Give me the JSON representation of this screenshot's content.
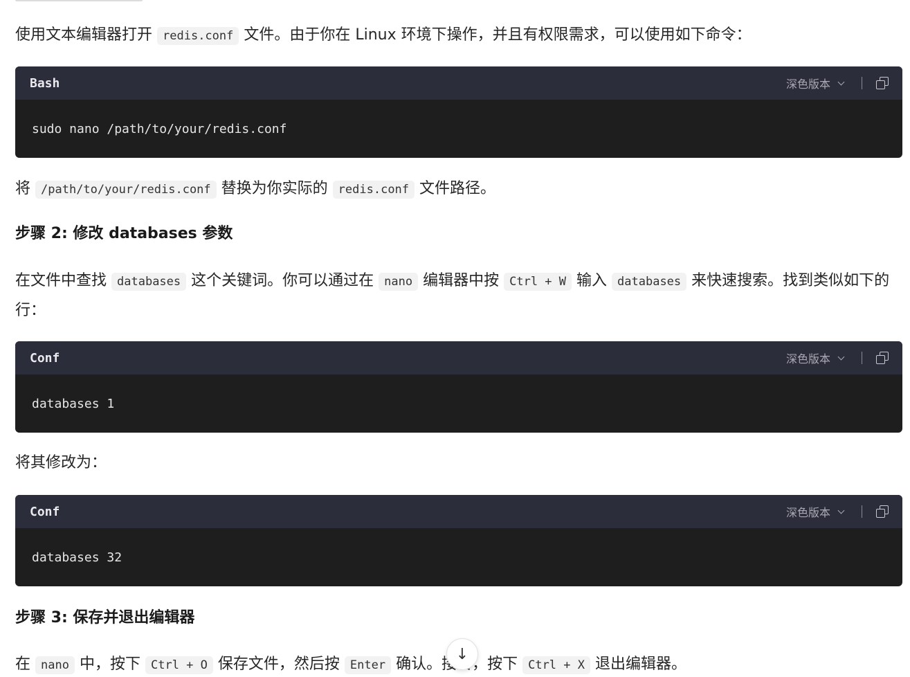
{
  "p1": {
    "before": "使用文本编辑器打开",
    "code1": "redis.conf",
    "after": "文件。由于你在 Linux 环境下操作，并且有权限需求，可以使用如下命令："
  },
  "code_blocks": [
    {
      "lang": "Bash",
      "theme_label": "深色版本",
      "content": "sudo nano /path/to/your/redis.conf"
    },
    {
      "lang": "Conf",
      "theme_label": "深色版本",
      "content": "databases 1"
    },
    {
      "lang": "Conf",
      "theme_label": "深色版本",
      "content": "databases 32"
    }
  ],
  "p2": {
    "t1": "将",
    "code1": "/path/to/your/redis.conf",
    "t2": "替换为你实际的",
    "code2": "redis.conf",
    "t3": "文件路径。"
  },
  "step2_heading": "步骤 2: 修改 databases 参数",
  "p3": {
    "t1": "在文件中查找",
    "code1": "databases",
    "t2": "这个关键词。你可以通过在",
    "code2": "nano",
    "t3": "编辑器中按",
    "code3": "Ctrl + W",
    "t4": "输入",
    "code4": "databases",
    "t5": "来快速搜索。找到类似如下的行："
  },
  "p4": "将其修改为：",
  "step3_heading": "步骤 3: 保存并退出编辑器",
  "p5": {
    "t1": "在",
    "code1": "nano",
    "t2": "中，按下",
    "code2": "Ctrl + O",
    "t3": "保存文件，然后按",
    "code3": "Enter",
    "t4": "确认。接着，按下",
    "code4": "Ctrl + X",
    "t5": "退出编辑器。"
  },
  "scroll_button": {
    "icon": "arrow-down-icon",
    "glyph": "↓"
  }
}
